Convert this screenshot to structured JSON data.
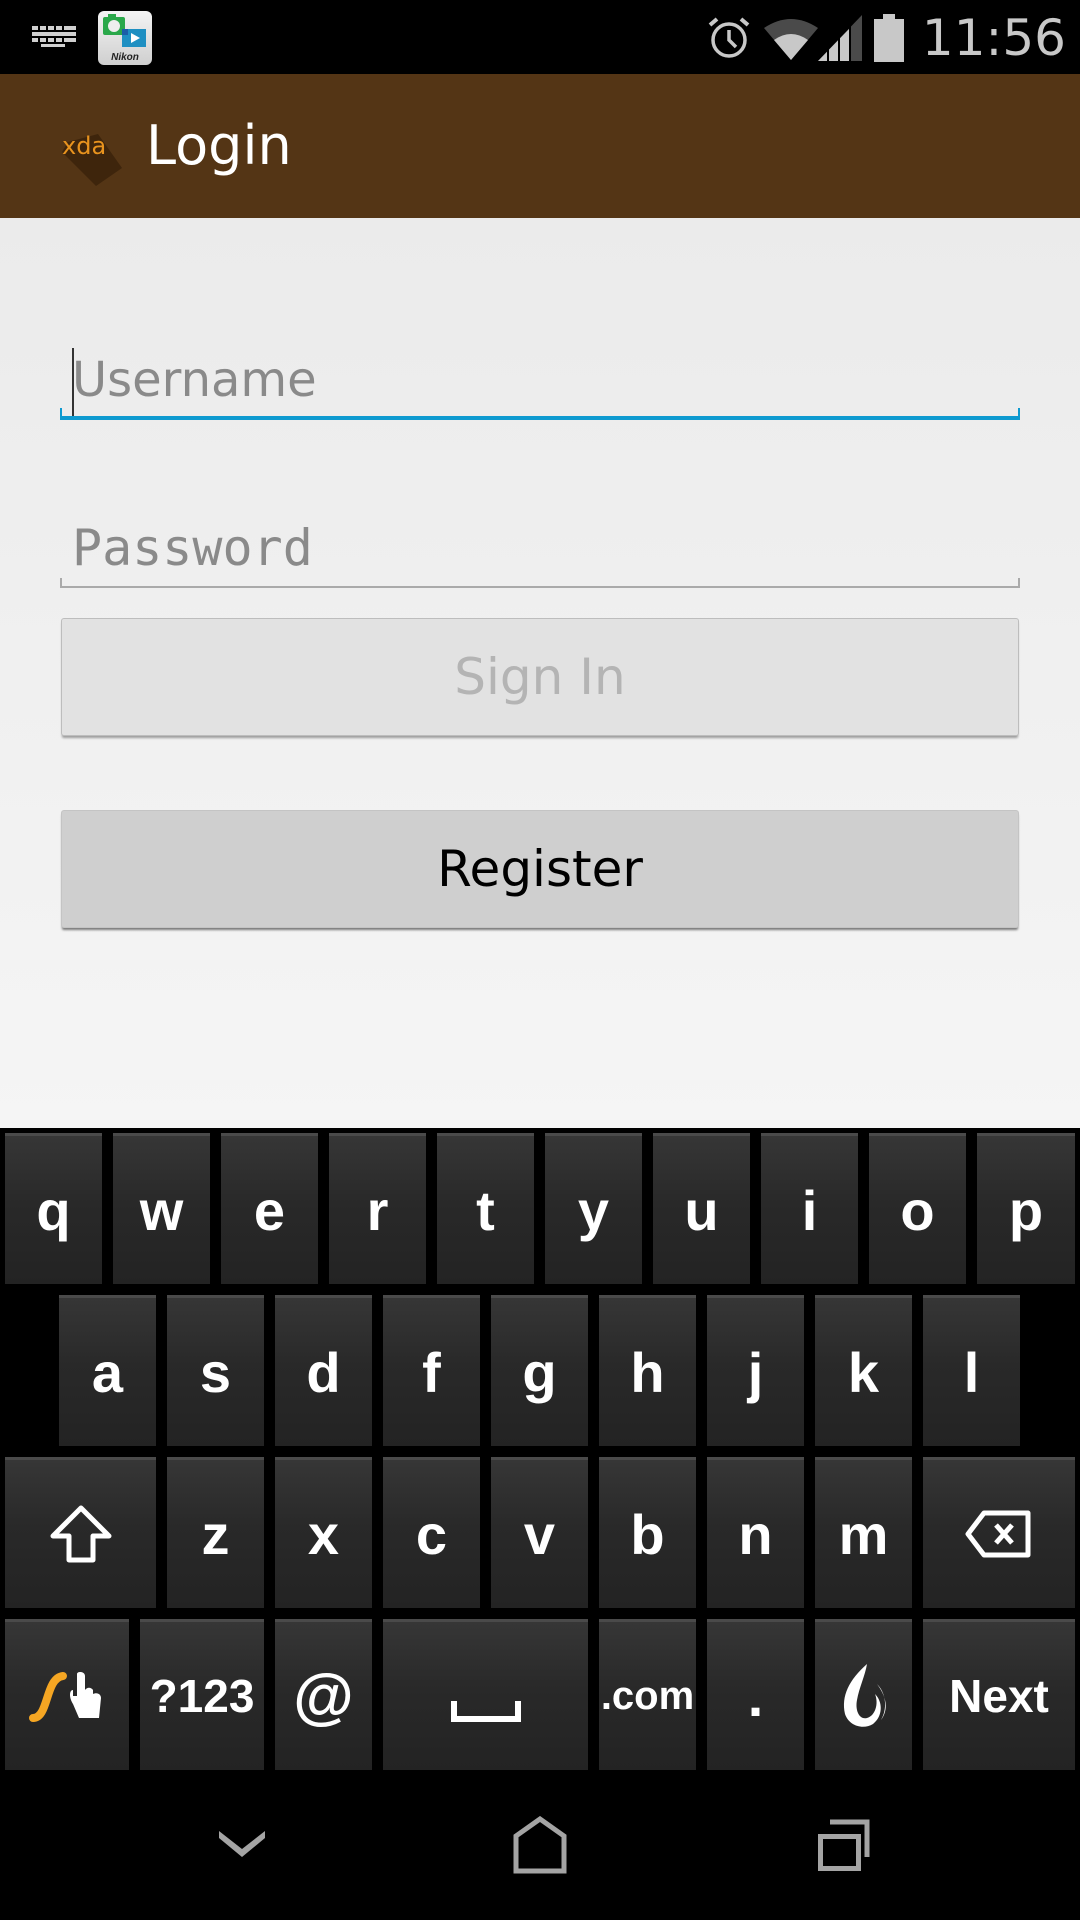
{
  "status_bar": {
    "time": "11:56",
    "notification_icons": [
      "keyboard-icon",
      "nikon-app-icon"
    ],
    "nikon_label": "Nikon",
    "system_icons": [
      "alarm-icon",
      "wifi-icon",
      "signal-icon",
      "battery-icon"
    ]
  },
  "action_bar": {
    "logo_text": "xda",
    "title": "Login"
  },
  "form": {
    "username": {
      "value": "",
      "placeholder": "Username",
      "focused": true
    },
    "password": {
      "value": "",
      "placeholder": "Password"
    },
    "sign_in_label": "Sign In",
    "sign_in_enabled": false,
    "register_label": "Register"
  },
  "colors": {
    "action_bar": "#543515",
    "focus_accent": "#0e9ad0",
    "swype_accent": "#f5a623"
  },
  "keyboard": {
    "row1": [
      "q",
      "w",
      "e",
      "r",
      "t",
      "y",
      "u",
      "i",
      "o",
      "p"
    ],
    "row2": [
      "a",
      "s",
      "d",
      "f",
      "g",
      "h",
      "j",
      "k",
      "l"
    ],
    "row3": [
      "z",
      "x",
      "c",
      "v",
      "b",
      "n",
      "m"
    ],
    "row4": {
      "swype": "swype-icon",
      "symbols": "?123",
      "at": "@",
      "space": "space-icon",
      "dotcom": ".com",
      "period": ".",
      "dragon": "dragon-voice-icon",
      "action": "Next"
    },
    "shift": "shift-icon",
    "backspace": "backspace-icon"
  },
  "nav_bar": {
    "buttons": [
      "hide-keyboard-icon",
      "home-icon",
      "recent-apps-icon"
    ]
  }
}
